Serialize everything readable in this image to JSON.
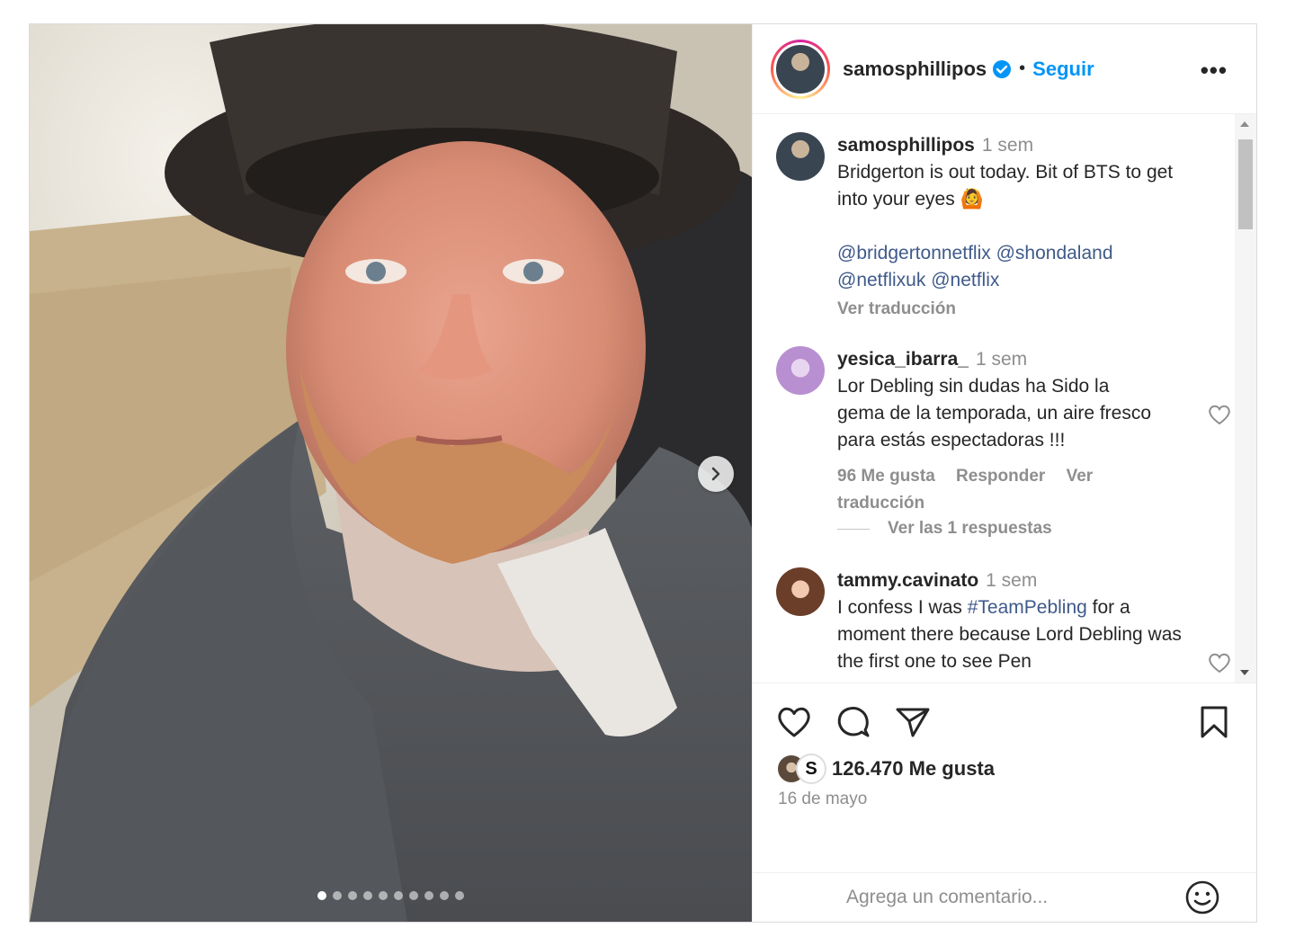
{
  "header": {
    "username": "samosphillipos",
    "separator": "•",
    "follow_label": "Seguir",
    "more_label": "•••"
  },
  "caption": {
    "username": "samosphillipos",
    "time": "1 sem",
    "text": "Bridgerton is out today. Bit of BTS to get into your eyes 🙆",
    "mentions": [
      "@bridgertonnetflix",
      "@shondaland",
      "@netflixuk",
      "@netflix"
    ],
    "translate_label": "Ver traducción"
  },
  "comments": [
    {
      "username": "yesica_ibarra_",
      "time": "1 sem",
      "text": "Lor Debling sin dudas ha Sido la gema de la temporada, un aire fresco para estás espectadoras !!!",
      "likes": "96 Me gusta",
      "reply_label": "Responder",
      "translate_label": "Ver traducción",
      "view_replies": "Ver las 1 respuestas"
    },
    {
      "username": "tammy.cavinato",
      "time": "1 sem",
      "text_before": "I confess I was ",
      "hashtag": "#TeamPebling",
      "text_after": " for a moment there because Lord Debling was the first one to see Pen"
    }
  ],
  "actions": {
    "likes_label": "126.470 Me gusta",
    "date": "16 de mayo",
    "liker_initial": "S"
  },
  "add_comment": {
    "placeholder": "Agrega un comentario..."
  },
  "carousel": {
    "total_slides": 10,
    "active_index": 0
  },
  "icons": {
    "verified": "verified-badge-icon",
    "more": "more-options-icon",
    "next": "chevron-right-icon",
    "heart": "heart-icon",
    "comment": "comment-bubble-icon",
    "share": "paper-plane-icon",
    "save": "bookmark-icon",
    "emoji": "emoji-smile-icon"
  },
  "colors": {
    "accent": "#0095f6",
    "verified": "#0095f6",
    "link": "#3f5a8a",
    "muted": "#8e8e8e"
  }
}
